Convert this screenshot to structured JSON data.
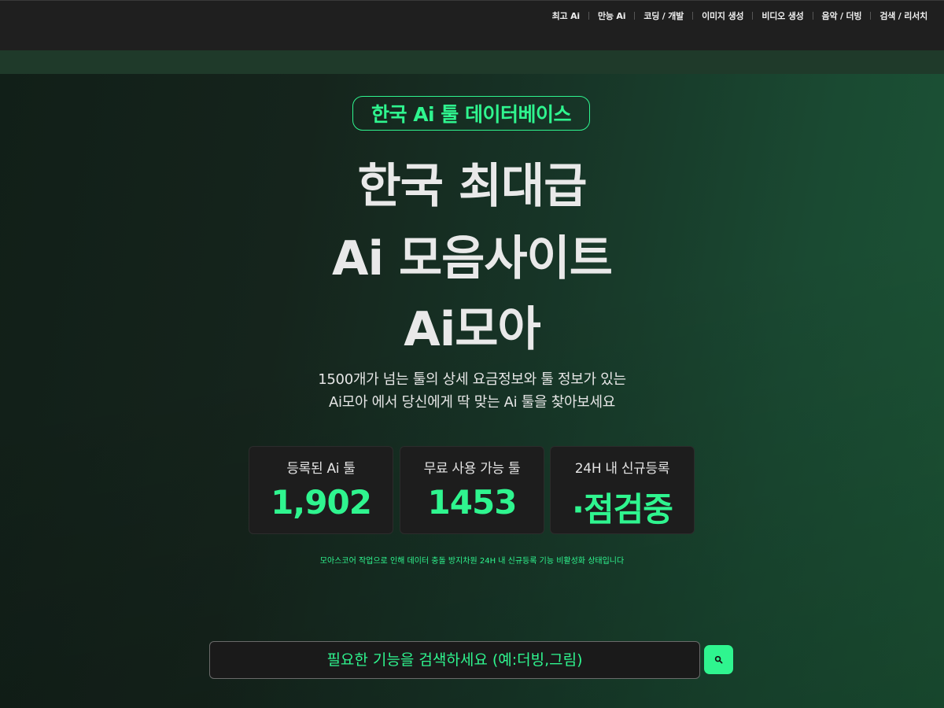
{
  "nav": {
    "items": [
      {
        "label": "최고 Ai"
      },
      {
        "label": "만능 Ai"
      },
      {
        "label": "코딩 / 개발"
      },
      {
        "label": "이미지 생성"
      },
      {
        "label": "비디오 생성"
      },
      {
        "label": "음악 / 더빙"
      },
      {
        "label": "검색 / 리서치"
      }
    ]
  },
  "hero": {
    "badge": "한국 Ai 툴 데이터베이스",
    "title_line1": "한국 최대급",
    "title_line2": "Ai 모음사이트",
    "title_line3": "Ai모아",
    "subtitle_line1": "1500개가 넘는 툴의 상세 요금정보와 툴 정보가 있는",
    "subtitle_line2": "Ai모아 에서 당신에게 딱 맞는 Ai 툴을 찾아보세요"
  },
  "stats": [
    {
      "label": "등록된 Ai 툴",
      "value": "1,902"
    },
    {
      "label": "무료 사용 가능 툴",
      "value": "1453"
    },
    {
      "label": "24H 내 신규등록",
      "value": "·점검중"
    }
  ],
  "notice": "모아스코어 작업으로 인해 데이터 충돌 방지차원 24H 내 신규등록 기능 비활성화 상태입니다",
  "search": {
    "placeholder": "필요한 기능을 검색하세요 (예:더빙,그림)",
    "value": "",
    "button_icon": "search-icon"
  },
  "colors": {
    "accent": "#2ff58f",
    "topbar": "#1f1f1f",
    "card": "#1d1d1d"
  }
}
